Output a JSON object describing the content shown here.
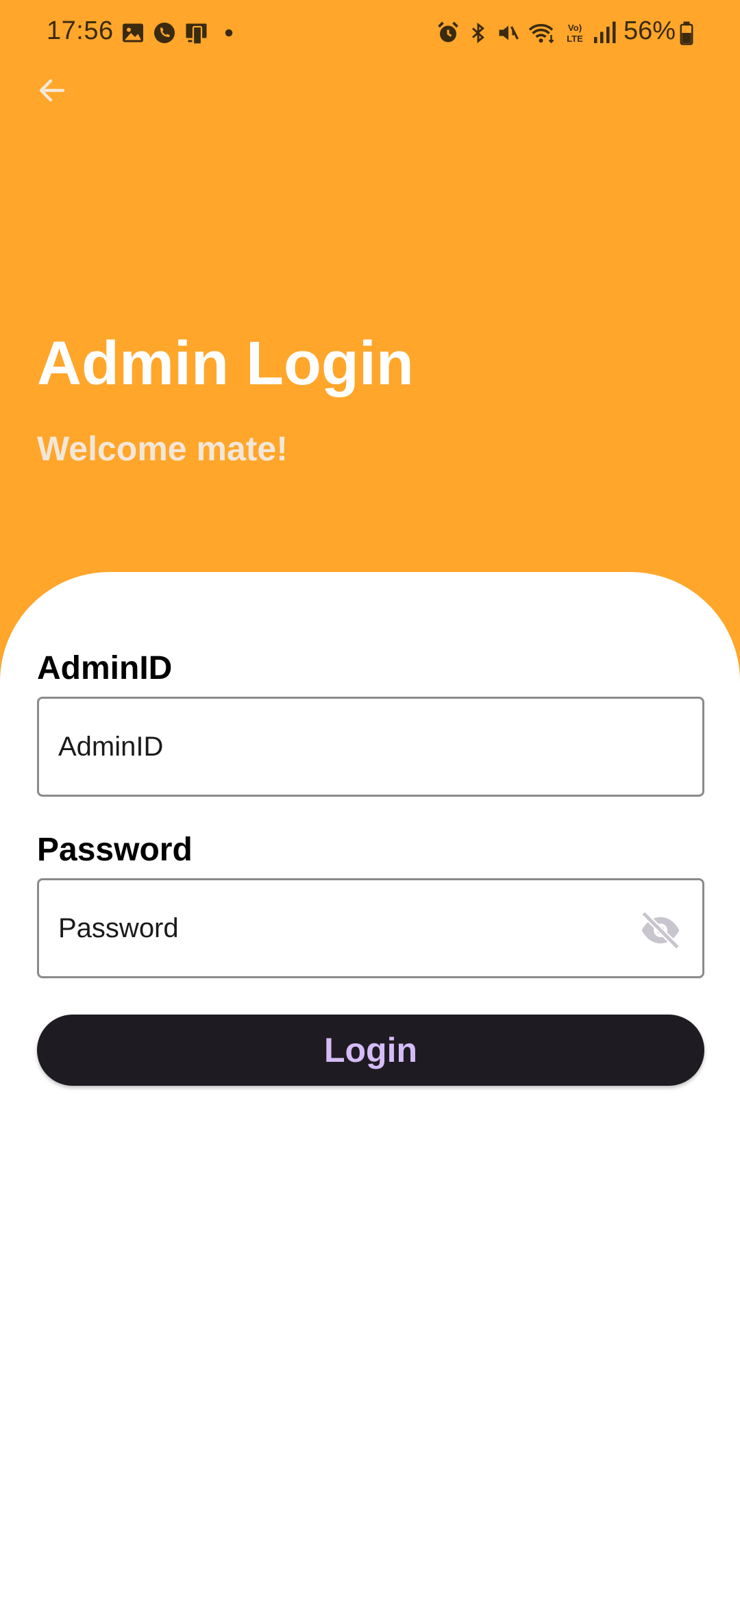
{
  "status_bar": {
    "time": "17:56",
    "battery": "56%",
    "left_icons": [
      "gallery-icon",
      "call-icon",
      "cast-icon",
      "dot-icon"
    ],
    "right_icons": [
      "alarm-icon",
      "bluetooth-icon",
      "mute-icon",
      "wifi-icon",
      "volte-icon",
      "signal-icon",
      "battery-icon"
    ],
    "volte_text": "Vo) LTE"
  },
  "header": {
    "title": "Admin Login",
    "subtitle": "Welcome mate!",
    "background_color": "#FFA62B"
  },
  "form": {
    "admin_id": {
      "label": "AdminID",
      "placeholder": "AdminID",
      "value": ""
    },
    "password": {
      "label": "Password",
      "placeholder": "Password",
      "value": "",
      "toggle_icon": "eye-off-icon"
    },
    "login_button": {
      "label": "Login",
      "background_color": "#1E1C22",
      "text_color": "#D5BCF7"
    }
  }
}
